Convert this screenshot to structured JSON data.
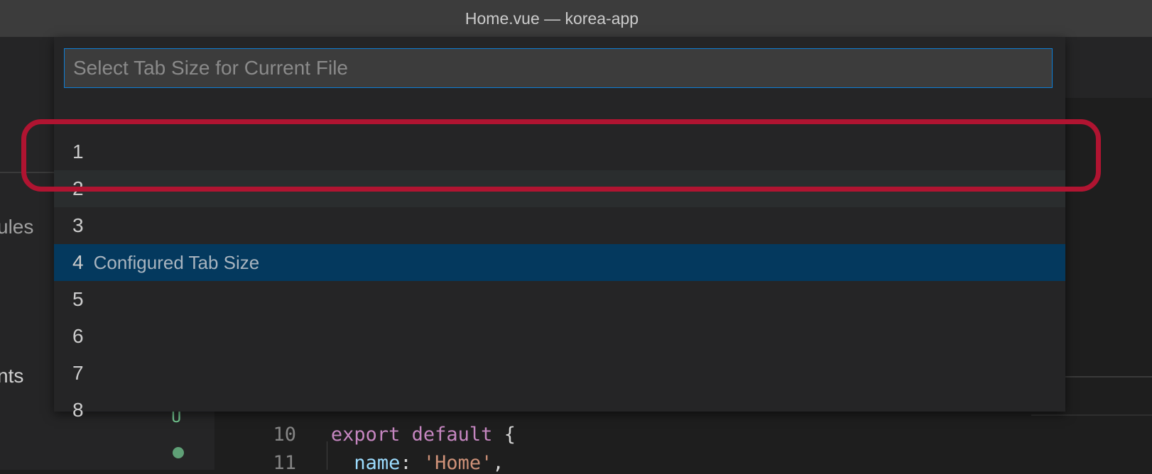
{
  "window": {
    "title": "Home.vue — korea-app"
  },
  "sidebar": {
    "modules_fragment": "ules",
    "components_fragment": "nts"
  },
  "git": {
    "untracked_badge": "U"
  },
  "editor": {
    "lines": [
      {
        "number": "10",
        "keyword1": "export",
        "keyword2": "default",
        "rest": "{"
      },
      {
        "number": "11",
        "prop": "name",
        "colon": ":",
        "string": "'Home'",
        "rest": ","
      }
    ]
  },
  "quickpick": {
    "placeholder": "Select Tab Size for Current File",
    "items": [
      {
        "label": "1",
        "description": ""
      },
      {
        "label": "2",
        "description": ""
      },
      {
        "label": "3",
        "description": ""
      },
      {
        "label": "4",
        "description": "Configured Tab Size"
      },
      {
        "label": "5",
        "description": ""
      },
      {
        "label": "6",
        "description": ""
      },
      {
        "label": "7",
        "description": ""
      },
      {
        "label": "8",
        "description": ""
      }
    ],
    "focused_index": 3,
    "hover_index": 1
  },
  "colors": {
    "accent_border": "#0e7ed6",
    "focus_row": "#04395e",
    "annotation": "#b01431"
  }
}
